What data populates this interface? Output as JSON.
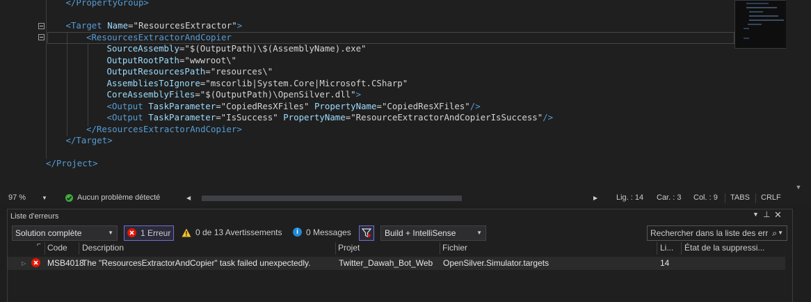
{
  "editor": {
    "lines": [
      {
        "indent": 1,
        "parts": [
          [
            "tag",
            "&lt;/"
          ],
          [
            "tag",
            "PropertyGroup"
          ],
          [
            "tag",
            "&gt;"
          ]
        ]
      },
      {
        "indent": 0,
        "parts": []
      },
      {
        "indent": 1,
        "parts": [
          [
            "tag",
            "<"
          ],
          [
            "tag",
            "Target"
          ],
          [
            "val",
            " "
          ],
          [
            "attr",
            "Name"
          ],
          [
            "eq",
            "="
          ],
          [
            "val",
            "\"ResourcesExtractor\""
          ],
          [
            "tag",
            ">"
          ]
        ]
      },
      {
        "indent": 2,
        "parts": [
          [
            "tag",
            "<"
          ],
          [
            "tag",
            "ResourcesExtractorAndCopier"
          ]
        ]
      },
      {
        "indent": 3,
        "parts": [
          [
            "attr",
            "SourceAssembly"
          ],
          [
            "eq",
            "="
          ],
          [
            "val",
            "\"$(OutputPath)\\$(AssemblyName).exe\""
          ]
        ]
      },
      {
        "indent": 3,
        "parts": [
          [
            "attr",
            "OutputRootPath"
          ],
          [
            "eq",
            "="
          ],
          [
            "val",
            "\"wwwroot\\\""
          ]
        ]
      },
      {
        "indent": 3,
        "parts": [
          [
            "attr",
            "OutputResourcesPath"
          ],
          [
            "eq",
            "="
          ],
          [
            "val",
            "\"resources\\\""
          ]
        ]
      },
      {
        "indent": 3,
        "parts": [
          [
            "attr",
            "AssembliesToIgnore"
          ],
          [
            "eq",
            "="
          ],
          [
            "val",
            "\"mscorlib|System.Core|Microsoft.CSharp\""
          ]
        ]
      },
      {
        "indent": 3,
        "parts": [
          [
            "attr",
            "CoreAssemblyFiles"
          ],
          [
            "eq",
            "="
          ],
          [
            "val",
            "\"$(OutputPath)\\OpenSilver.dll\""
          ],
          [
            "tag",
            ">"
          ]
        ]
      },
      {
        "indent": 3,
        "parts": [
          [
            "tag",
            "<"
          ],
          [
            "tag",
            "Output"
          ],
          [
            "val",
            " "
          ],
          [
            "attr",
            "TaskParameter"
          ],
          [
            "eq",
            "="
          ],
          [
            "val",
            "\"CopiedResXFiles\""
          ],
          [
            "val",
            " "
          ],
          [
            "attr",
            "PropertyName"
          ],
          [
            "eq",
            "="
          ],
          [
            "val",
            "\"CopiedResXFiles\""
          ],
          [
            "tag",
            "/>"
          ]
        ]
      },
      {
        "indent": 3,
        "parts": [
          [
            "tag",
            "<"
          ],
          [
            "tag",
            "Output"
          ],
          [
            "val",
            " "
          ],
          [
            "attr",
            "TaskParameter"
          ],
          [
            "eq",
            "="
          ],
          [
            "val",
            "\"IsSuccess\""
          ],
          [
            "val",
            " "
          ],
          [
            "attr",
            "PropertyName"
          ],
          [
            "eq",
            "="
          ],
          [
            "val",
            "\"ResourceExtractorAndCopierIsSuccess\""
          ],
          [
            "tag",
            "/>"
          ]
        ]
      },
      {
        "indent": 2,
        "parts": [
          [
            "tag",
            "</"
          ],
          [
            "tag",
            "ResourcesExtractorAndCopier"
          ],
          [
            "tag",
            ">"
          ]
        ]
      },
      {
        "indent": 1,
        "parts": [
          [
            "tag",
            "</"
          ],
          [
            "tag",
            "Target"
          ],
          [
            "tag",
            ">"
          ]
        ]
      },
      {
        "indent": 0,
        "parts": []
      },
      {
        "indent": 0,
        "parts": [
          [
            "tag",
            "</"
          ],
          [
            "tag",
            "Project"
          ],
          [
            "tag",
            ">"
          ]
        ]
      }
    ]
  },
  "status": {
    "zoom": "97 %",
    "issues": "Aucun problème détecté",
    "line": "Lig. : 14",
    "char": "Car. : 3",
    "col": "Col. : 9",
    "indent_mode": "TABS",
    "line_ending": "CRLF"
  },
  "error_list": {
    "title": "Liste d'erreurs",
    "scope": "Solution complète",
    "errors": "1 Erreur",
    "warnings": "0 de 13 Avertissements",
    "messages": "0 Messages",
    "build_filter": "Build + IntelliSense",
    "search_placeholder": "Rechercher dans la liste des err",
    "columns": {
      "code": "Code",
      "description": "Description",
      "project": "Projet",
      "file": "Fichier",
      "line": "Li...",
      "suppression": "État de la suppressi..."
    },
    "rows": [
      {
        "code": "MSB4018",
        "description": "The \"ResourcesExtractorAndCopier\" task failed unexpectedly.",
        "project": "Twitter_Dawah_Bot_Web",
        "file": "OpenSilver.Simulator.targets",
        "line": "14",
        "suppression": ""
      }
    ]
  },
  "colors": {
    "tag": "#569cd6",
    "attribute": "#9cdcfe",
    "value": "#d4d4d4",
    "error": "#e51400",
    "success": "#3eab3e"
  }
}
